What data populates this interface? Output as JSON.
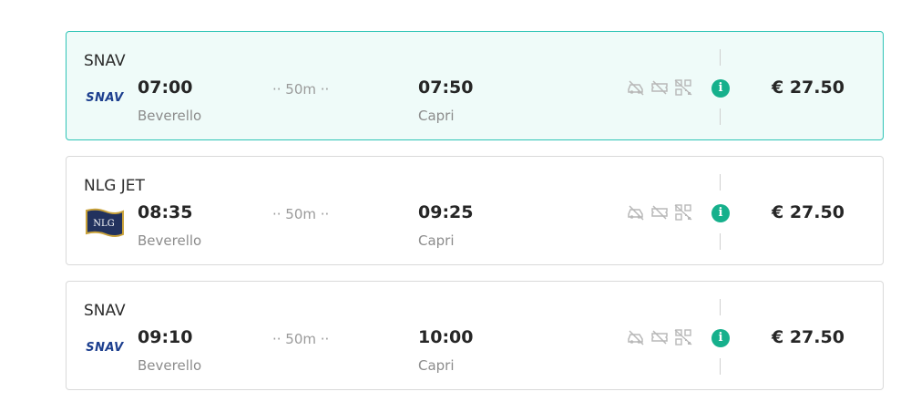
{
  "trips": [
    {
      "operator": "SNAV",
      "logo": "snav-logo",
      "logo_text": "SNAV",
      "departure_time": "07:00",
      "departure_port": "Beverello",
      "duration": "·· 50m ··",
      "arrival_time": "07:50",
      "arrival_port": "Capri",
      "price": "€ 27.50",
      "selected": true
    },
    {
      "operator": "NLG JET",
      "logo": "nlg-flag-logo",
      "logo_text": "NLG",
      "departure_time": "08:35",
      "departure_port": "Beverello",
      "duration": "·· 50m ··",
      "arrival_time": "09:25",
      "arrival_port": "Capri",
      "price": "€ 27.50",
      "selected": false
    },
    {
      "operator": "SNAV",
      "logo": "snav-logo",
      "logo_text": "SNAV",
      "departure_time": "09:10",
      "departure_port": "Beverello",
      "duration": "·· 50m ··",
      "arrival_time": "10:00",
      "arrival_port": "Capri",
      "price": "€ 27.50",
      "selected": false
    }
  ],
  "amenity_icons": [
    "no-car-icon",
    "no-ticket-icon",
    "no-qr-code-icon"
  ],
  "info_icon": "info-icon",
  "colors": {
    "selected_border": "#2ec4b6",
    "selected_background": "#effbf9",
    "info": "#16b08c",
    "snav_blue": "#1d3f8f",
    "nlg_navy": "#22325e",
    "nlg_gold": "#c9a23a"
  }
}
